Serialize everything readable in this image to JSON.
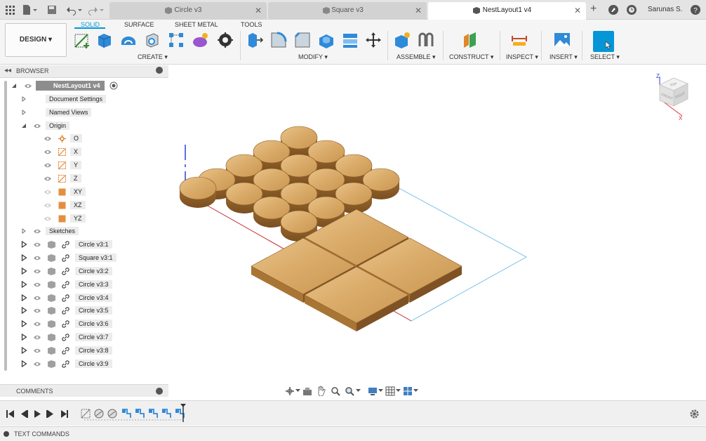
{
  "quick_access": {
    "user": "Sarunas S."
  },
  "tabs": [
    {
      "label": "Circle v3",
      "active": false
    },
    {
      "label": "Square v3",
      "active": false
    },
    {
      "label": "NestLayout1 v4",
      "active": true
    }
  ],
  "toolbar": {
    "workspace": "DESIGN",
    "workspace_tabs": [
      "SOLID",
      "SURFACE",
      "SHEET METAL",
      "TOOLS"
    ],
    "active_tab": "SOLID",
    "groups": [
      "CREATE",
      "MODIFY",
      "ASSEMBLE",
      "CONSTRUCT",
      "INSPECT",
      "INSERT",
      "SELECT"
    ],
    "accent": "#0696d7"
  },
  "browser": {
    "title": "BROWSER",
    "root": "NestLayout1 v4",
    "items": [
      {
        "label": "Document Settings"
      },
      {
        "label": "Named Views"
      },
      {
        "label": "Origin"
      },
      {
        "label": "O"
      },
      {
        "label": "X"
      },
      {
        "label": "Y"
      },
      {
        "label": "Z"
      },
      {
        "label": "XY"
      },
      {
        "label": "XZ"
      },
      {
        "label": "YZ"
      },
      {
        "label": "Sketches"
      },
      {
        "label": "Circle v3:1"
      },
      {
        "label": "Square v3:1"
      },
      {
        "label": "Circle v3:2"
      },
      {
        "label": "Circle v3:3"
      },
      {
        "label": "Circle v3:4"
      },
      {
        "label": "Circle v3:5"
      },
      {
        "label": "Circle v3:6"
      },
      {
        "label": "Circle v3:7"
      },
      {
        "label": "Circle v3:8"
      },
      {
        "label": "Circle v3:9"
      }
    ]
  },
  "comments": {
    "title": "COMMENTS"
  },
  "viewcube": {
    "top": "TOP",
    "front": "FRONT",
    "right": "RIGHT",
    "axis_z": "Z",
    "axis_x": "X"
  },
  "text_commands": {
    "label": "TEXT COMMANDS"
  }
}
